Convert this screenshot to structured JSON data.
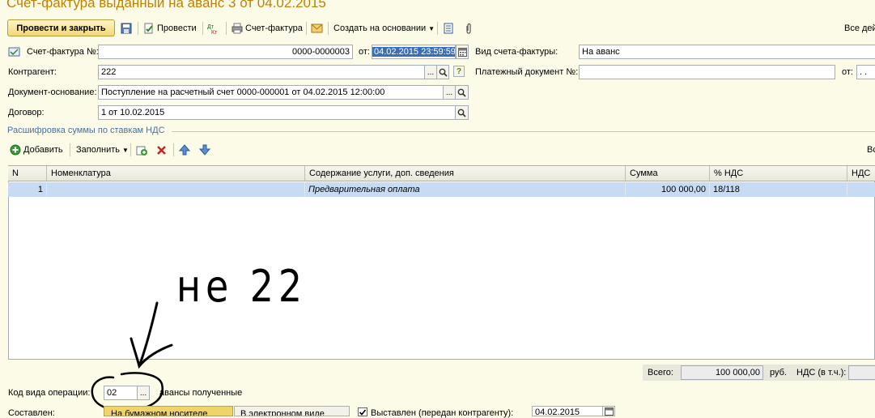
{
  "window": {
    "title": "Счет-фактура выданный на аванс 3 от 04.02.2015"
  },
  "toolbar": {
    "post_close": "Провести и закрыть",
    "post": "Провести",
    "invoice": "Счет-фактура",
    "create_based": "Создать на основании",
    "all_actions": "Все дей"
  },
  "header": {
    "invoice_num_label": "Счет-фактура №:",
    "invoice_num_value": "0000-0000003",
    "from_label": "от:",
    "date_value": "04.02.2015 23:59:59",
    "kind_label": "Вид счета-фактуры:",
    "kind_value": "На аванс",
    "counterparty_label": "Контрагент:",
    "counterparty_value": "222",
    "help_label": "?",
    "payment_doc_label": "Платежный документ №:",
    "payment_doc_value": "",
    "payment_from_label": "от:",
    "payment_date_value": ". .",
    "base_doc_label": "Документ-основание:",
    "base_doc_value": "Поступление на расчетный счет 0000-000001 от 04.02.2015 12:00:00",
    "contract_label": "Договор:",
    "contract_value": "1 от 10.02.2015",
    "dots": "..."
  },
  "vat_section": {
    "title": "Расшифровка суммы по ставкам НДС",
    "add": "Добавить",
    "fill": "Заполнить",
    "all_right": "Вс"
  },
  "grid": {
    "columns": [
      "N",
      "Номенклатура",
      "Содержание услуги, доп. сведения",
      "Сумма",
      "% НДС",
      "НДС"
    ],
    "rows": [
      {
        "n": "1",
        "nomenclature": "",
        "content": "Предварительная оплата",
        "sum": "100 000,00",
        "vat_rate": "18/118",
        "vat": ""
      }
    ]
  },
  "annotation": {
    "text": "не 22"
  },
  "totals": {
    "total_label": "Всего:",
    "total_value": "100 000,00",
    "currency": "руб.",
    "vat_label": "НДС (в т.ч.):"
  },
  "operation": {
    "code_label": "Код вида операции:",
    "code_value": "02",
    "code_desc": "авансы полученные"
  },
  "compiled": {
    "label": "Составлен:",
    "paper": "На бумажном носителе",
    "electronic": "В электронном виде",
    "issued_label": "Выставлен (передан контрагенту):",
    "issued_date": "04.02.2015"
  }
}
